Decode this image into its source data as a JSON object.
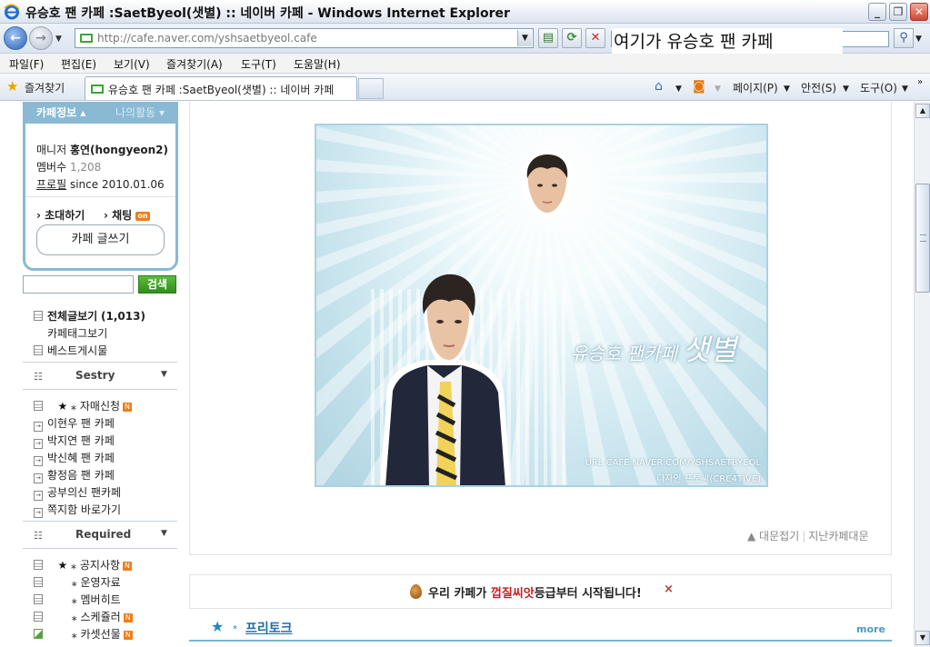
{
  "window": {
    "title": "유승호 팬 카페 :SaetByeol(샛별) :: 네이버 카페 - Windows Internet Explorer",
    "minimize": "_",
    "maximize": "❐",
    "close": "✕"
  },
  "address": {
    "url": "http://cafe.naver.com/yshsaetbyeol.cafe",
    "overlay_note": "여기가 유승호 팬 카페"
  },
  "menu": [
    "파일(F)",
    "편집(E)",
    "보기(V)",
    "즐겨찾기(A)",
    "도구(T)",
    "도움말(H)"
  ],
  "tabs": {
    "favorites": "즐겨찾기",
    "active_tab": "유승호 팬 카페 :SaetByeol(샛별) :: 네이버 카페",
    "commands": [
      "페이지(P)",
      "안전(S)",
      "도구(O)"
    ]
  },
  "sidebar": {
    "tab_info": "카페정보",
    "tab_activity": "나의활동",
    "manager_label": "매니저",
    "manager_value": "홍연(hongyeon2)",
    "members_label": "멤버수",
    "members_value": "1,208",
    "profile_label": "프로필",
    "profile_value": "since 2010.01.06",
    "invite": "초대하기",
    "chat": "채팅",
    "chat_badge": "on",
    "write_button": "카페 글쓰기",
    "search_button": "검색",
    "all_posts": "전체글보기",
    "all_posts_count": "(1,013)",
    "tag_view": "카페태그보기",
    "best_posts": "베스트게시물",
    "group1": "Sestry",
    "group1_items": [
      "자매신청",
      "이현우 팬   카페",
      "박지연 팬   카페",
      "박신혜 팬   카페",
      "황정음 팬   카페",
      "공부의신 팬카페",
      "쪽지함 바로가기"
    ],
    "group2": "Required",
    "group2_items": [
      "공지사항",
      "운영자료",
      "멤버히트",
      "스케쥴러",
      "카셋선물"
    ],
    "new_badge": "N"
  },
  "main": {
    "banner_brand_small": "유승호 팬카페",
    "banner_brand_big": "샛별",
    "banner_url": "URL CAFE.NAVER.COM/YSHSAETBYEOL",
    "banner_credit": "디자인.프토씨(CRE4TIVE)",
    "fold_link": "▲ 대문접기",
    "prev_link": "지난카페대문",
    "notice_prefix": "우리 카페가 ",
    "notice_highlight": "껍질씨앗",
    "notice_suffix": "등급부터 시작됩니다!",
    "notice_close": "×",
    "board_title": "프리토크",
    "board_more": "more"
  },
  "colors": {
    "sidebar_accent": "#89b9d3",
    "search_green": "#3a9a22",
    "highlight_red": "#c71c1c",
    "board_blue": "#1a6fa6"
  }
}
